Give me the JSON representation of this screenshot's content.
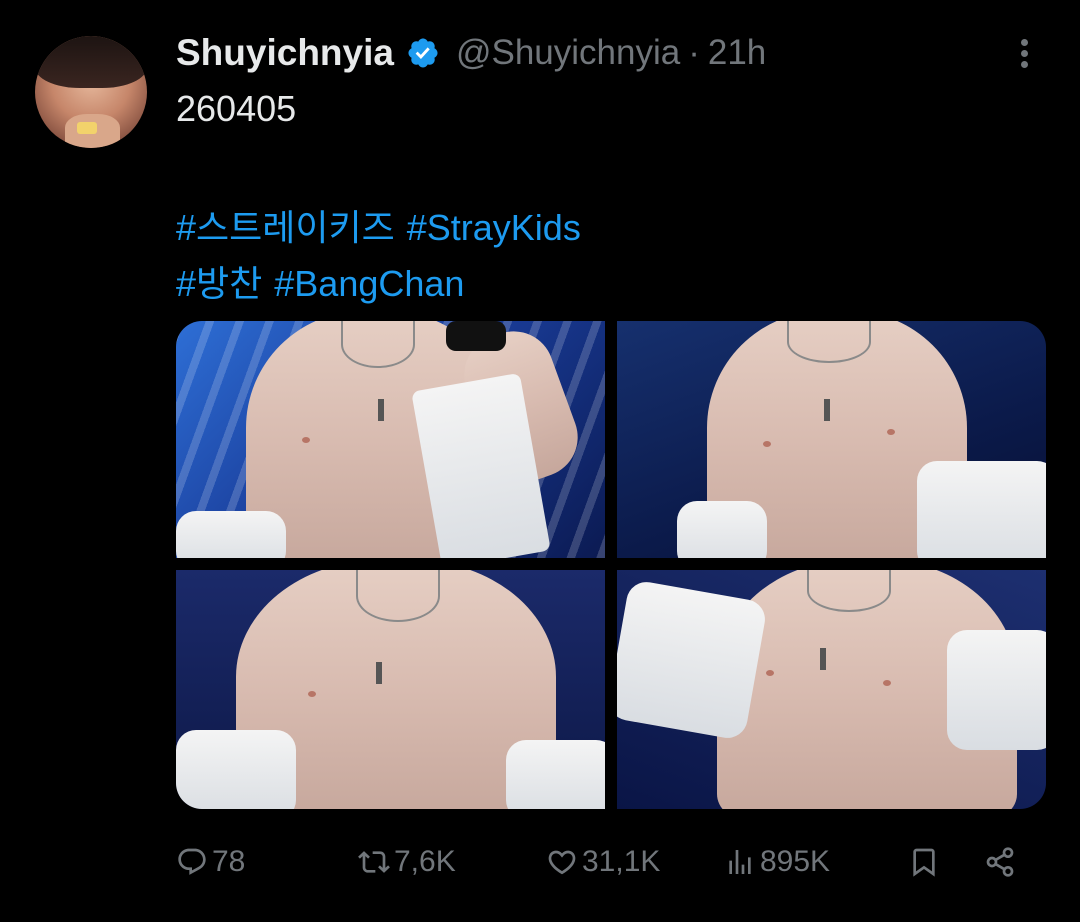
{
  "tweet": {
    "author_name": "Shuyichnyia",
    "handle": "@Shuyichnyia",
    "separator": "·",
    "time": "21h",
    "text_line1": "260405",
    "hashtags_line1": [
      "#스트레이키즈",
      "#StrayKids"
    ],
    "hashtags_line2": [
      "#방찬",
      "#BangChan"
    ],
    "media_count": 4
  },
  "actions": {
    "replies": "78",
    "retweets": "7,6K",
    "likes": "31,1K",
    "views": "895K"
  },
  "icons": {
    "verified": "verified-badge-icon",
    "more": "more-options-icon",
    "reply": "reply-icon",
    "retweet": "retweet-icon",
    "like": "heart-icon",
    "views": "views-icon",
    "bookmark": "bookmark-icon",
    "share": "share-icon"
  },
  "colors": {
    "background": "#000000",
    "primary_text": "#e7e9ea",
    "secondary_text": "#71767b",
    "link": "#1d9bf0",
    "verified": "#1d9bf0"
  }
}
